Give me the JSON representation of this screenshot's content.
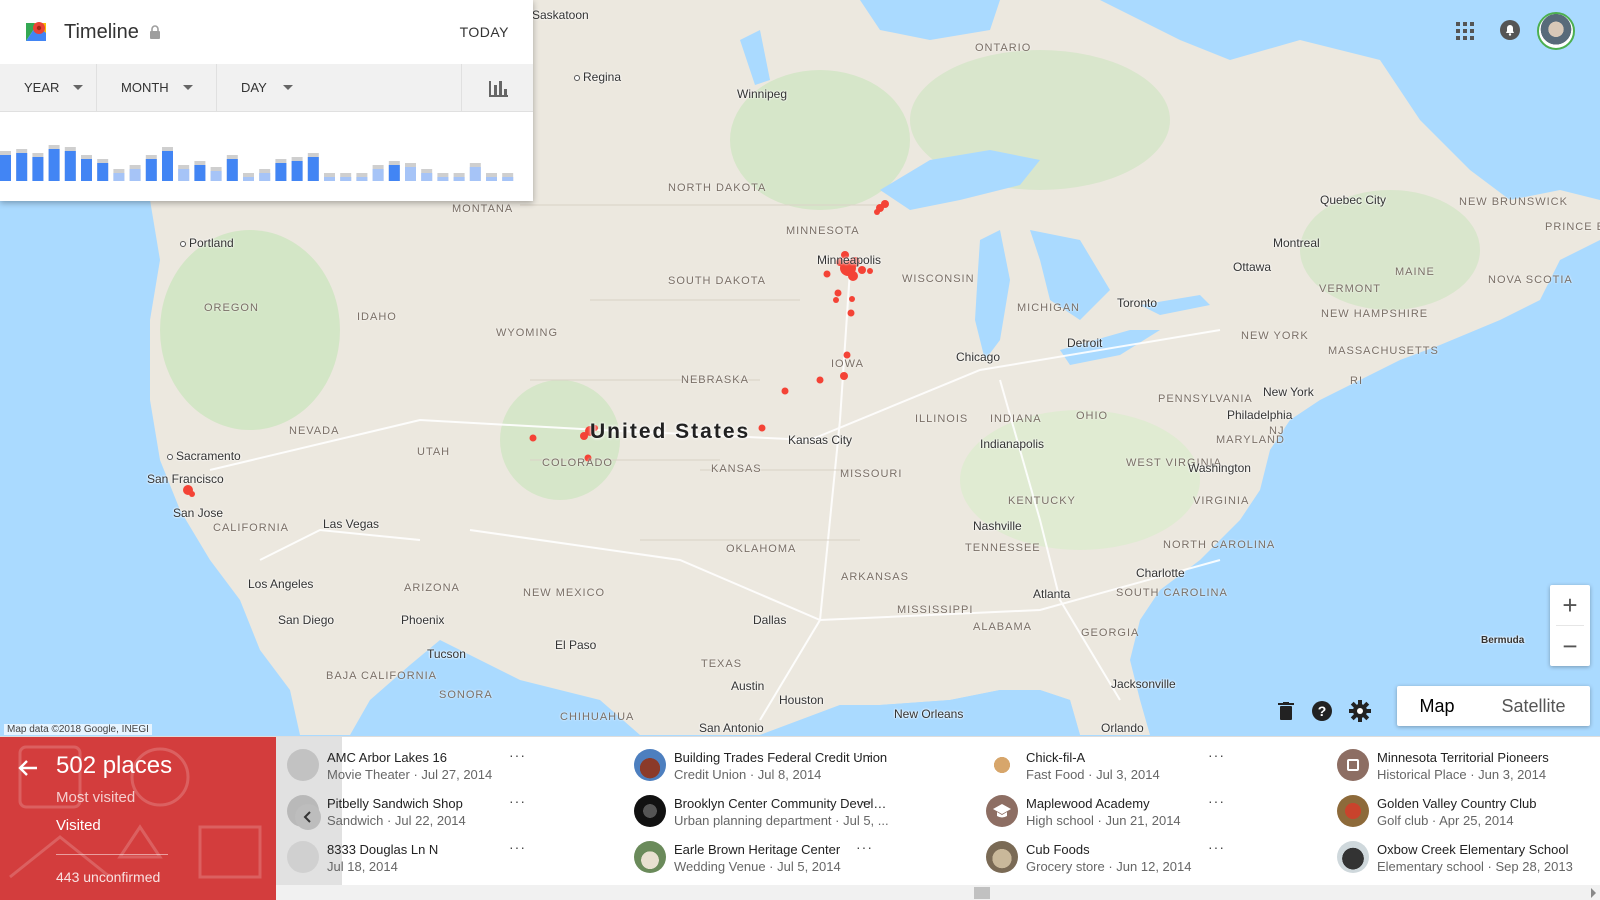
{
  "timeline": {
    "title": "Timeline",
    "today_label": "TODAY",
    "year_label": "YEAR",
    "month_label": "MONTH",
    "day_label": "DAY"
  },
  "map": {
    "attribution": "Map data ©2018 Google, INEGI",
    "country": "United States",
    "cities": [
      "Saskatoon",
      "Regina",
      "Winnipeg",
      "Portland",
      "Sacramento",
      "San Francisco",
      "San Jose",
      "Las Vegas",
      "Los Angeles",
      "San Diego",
      "Phoenix",
      "Tucson",
      "El Paso",
      "Minneapolis",
      "Kansas City",
      "Chicago",
      "Detroit",
      "Toronto",
      "Ottawa",
      "Montreal",
      "Quebec City",
      "New York",
      "Philadelphia",
      "Washington",
      "Indianapolis",
      "Nashville",
      "Charlotte",
      "Atlanta",
      "Dallas",
      "Austin",
      "Houston",
      "San Antonio",
      "New Orleans",
      "Jacksonville",
      "Orlando",
      "Bermuda"
    ],
    "regions": [
      "ONTARIO",
      "NORTH DAKOTA",
      "MINNESOTA",
      "MONTANA",
      "SOUTH DAKOTA",
      "OREGON",
      "IDAHO",
      "WYOMING",
      "WISCONSIN",
      "MICHIGAN",
      "NEBRASKA",
      "IOWA",
      "NEVADA",
      "UTAH",
      "COLORADO",
      "KANSAS",
      "MISSOURI",
      "ILLINOIS",
      "INDIANA",
      "OHIO",
      "CALIFORNIA",
      "ARIZONA",
      "NEW MEXICO",
      "OKLAHOMA",
      "ARKANSAS",
      "TENNESSEE",
      "KENTUCKY",
      "WEST VIRGINIA",
      "VIRGINIA",
      "NORTH CAROLINA",
      "SOUTH CAROLINA",
      "GEORGIA",
      "ALABAMA",
      "MISSISSIPPI",
      "TEXAS",
      "BAJA CALIFORNIA",
      "SONORA",
      "CHIHUAHUA",
      "NEW BRUNSWICK",
      "PRINCE EDWARD ISLAND",
      "NOVA SCOTIA",
      "MAINE",
      "VERMONT",
      "NEW HAMPSHIRE",
      "MASSACHUSETTS",
      "NEW YORK",
      "PENNSYLVANIA",
      "MARYLAND",
      "NJ",
      "RI"
    ],
    "dot_color": "#f44336"
  },
  "map_controls": {
    "zoom_in": "+",
    "zoom_out": "−",
    "map_label": "Map",
    "satellite_label": "Satellite"
  },
  "summary": {
    "count_label": "502 places",
    "most_visited_label": "Most visited",
    "visited_label": "Visited",
    "unconfirmed_label": "443 unconfirmed"
  },
  "places": [
    {
      "name": "AMC Arbor Lakes 16",
      "meta": "Movie Theater · Jul 27, 2014"
    },
    {
      "name": "Pitbelly Sandwich Shop",
      "meta": "Sandwich · Jul 22, 2014"
    },
    {
      "name": "8333 Douglas Ln N",
      "meta": "Jul 18, 2014"
    },
    {
      "name": "Building Trades Federal Credit Union",
      "meta": "Credit Union · Jul 8, 2014"
    },
    {
      "name": "Brooklyn Center Community Develo...",
      "meta": "Urban planning department · Jul 5, ..."
    },
    {
      "name": "Earle Brown Heritage Center",
      "meta": "Wedding Venue · Jul 5, 2014"
    },
    {
      "name": "Chick-fil-A",
      "meta": "Fast Food · Jul 3, 2014"
    },
    {
      "name": "Maplewood Academy",
      "meta": "High school · Jun 21, 2014"
    },
    {
      "name": "Cub Foods",
      "meta": "Grocery store · Jun 12, 2014"
    },
    {
      "name": "Minnesota Territorial Pioneers",
      "meta": "Historical Place · Jun 3, 2014"
    },
    {
      "name": "Golden Valley Country Club",
      "meta": "Golf club · Apr 25, 2014"
    },
    {
      "name": "Oxbow Creek Elementary School",
      "meta": "Elementary school · Sep 28, 2013"
    }
  ],
  "more_label": "···",
  "colors": {
    "accent_red": "#d33d3d",
    "bar_blue": "#4285f4",
    "bar_blue_light": "#a6c4f7",
    "bar_grey": "#cfcfcf"
  }
}
